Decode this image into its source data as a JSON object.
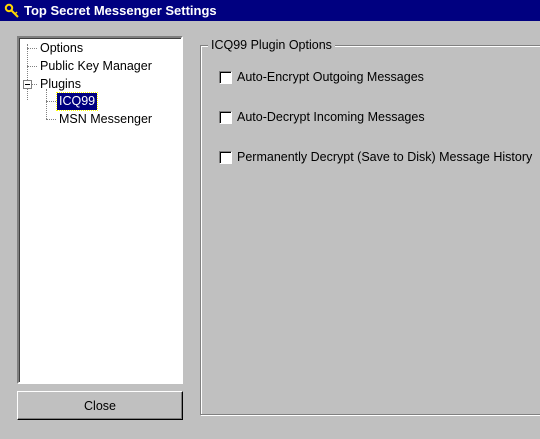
{
  "window": {
    "title": "Top Secret Messenger Settings",
    "icon": "key-icon"
  },
  "tree": {
    "items": [
      {
        "label": "Options"
      },
      {
        "label": "Public Key Manager"
      },
      {
        "label": "Plugins",
        "expanded": true
      },
      {
        "label": "ICQ99",
        "selected": true
      },
      {
        "label": "MSN Messenger"
      }
    ]
  },
  "close_button": {
    "label": "Close"
  },
  "group": {
    "label": "ICQ99 Plugin Options",
    "options": [
      {
        "label": "Auto-Encrypt Outgoing Messages",
        "checked": false
      },
      {
        "label": "Auto-Decrypt Incoming Messages",
        "checked": false
      },
      {
        "label": "Permanently Decrypt (Save to Disk) Message History",
        "checked": false
      }
    ]
  }
}
